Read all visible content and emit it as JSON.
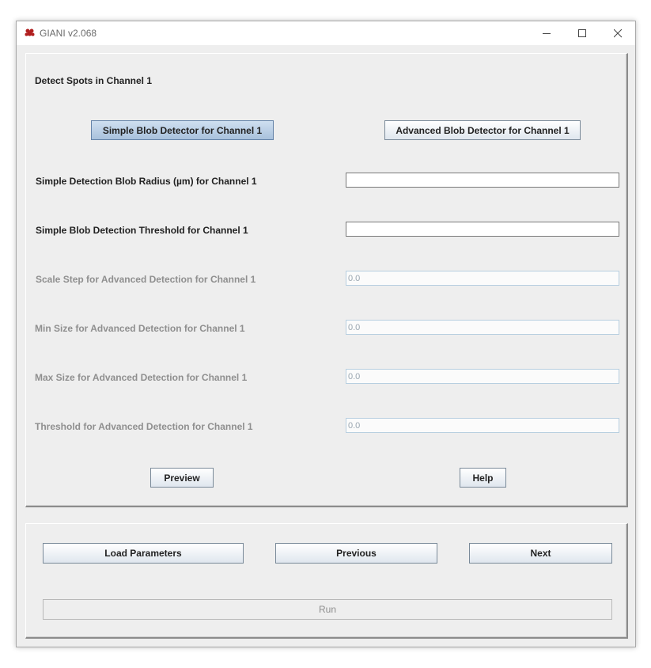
{
  "window": {
    "title": "GIANI v2.068"
  },
  "panel": {
    "heading": "Detect Spots in Channel 1",
    "simple_button": "Simple Blob Detector for Channel 1",
    "advanced_button": "Advanced Blob Detector for Channel 1",
    "rows": [
      {
        "label": "Simple Detection Blob Radius (µm) for Channel 1",
        "value": "",
        "enabled": true
      },
      {
        "label": "Simple Blob Detection Threshold for Channel 1",
        "value": "",
        "enabled": true
      },
      {
        "label": "Scale Step for Advanced Detection for Channel 1",
        "value": "0.0",
        "enabled": false
      },
      {
        "label": "Min Size for Advanced Detection for Channel 1",
        "value": "0.0",
        "enabled": false
      },
      {
        "label": "Max Size for Advanced Detection for Channel 1",
        "value": "0.0",
        "enabled": false
      },
      {
        "label": "Threshold for Advanced Detection for Channel 1",
        "value": "0.0",
        "enabled": false
      }
    ],
    "preview_button": "Preview",
    "help_button": "Help"
  },
  "footer": {
    "load_button": "Load Parameters",
    "previous_button": "Previous",
    "next_button": "Next",
    "run_button": "Run"
  },
  "colors": {
    "selected_button": "#a8c1dc",
    "disabled_text": "#8f8f8f",
    "app_icon": "#b01e1e"
  }
}
